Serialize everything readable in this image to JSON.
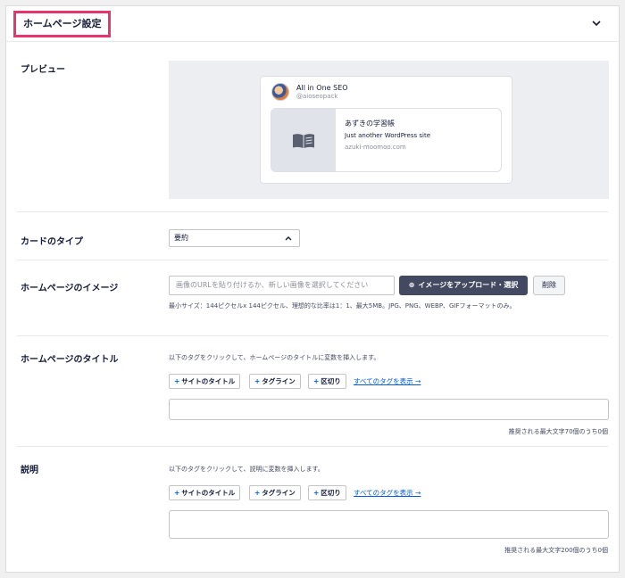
{
  "header": {
    "title": "ホームページ設定"
  },
  "preview": {
    "label": "プレビュー",
    "account_name": "All in One SEO",
    "account_handle": "@aioseopack",
    "card_title": "あずきの学習帳",
    "card_description": "Just another WordPress site",
    "card_url": "azuki-moomoo.com"
  },
  "card_type": {
    "label": "カードのタイプ",
    "selected": "要約"
  },
  "homepage_image": {
    "label": "ホームページのイメージ",
    "placeholder": "画像のURLを貼り付けるか、新しい画像を選択してください",
    "upload_label": "イメージをアップロード・選択",
    "delete_label": "削除",
    "hint": "最小サイズ：144ピクセルx 144ピクセル、理想的な比率は1：1、最大5MB。JPG、PNG、WEBP、GIFフォーマットのみ。"
  },
  "homepage_title": {
    "label": "ホームページのタイトル",
    "hint": "以下のタグをクリックして、ホームページのタイトルに変数を挿入します。",
    "tags": [
      "サイトのタイトル",
      "タグライン",
      "区切り"
    ],
    "show_all": "すべてのタグを表示 →",
    "value": "",
    "counter": "推奨される最大文字70個のうち0個"
  },
  "description": {
    "label": "説明",
    "hint": "以下のタグをクリックして、説明に変数を挿入します。",
    "tags": [
      "サイトのタイトル",
      "タグライン",
      "区切り"
    ],
    "show_all": "すべてのタグを表示 →",
    "value": "",
    "counter": "推奨される最大文字200個のうち0個"
  },
  "colors": {
    "accent_highlight": "#e8336d",
    "primary_button": "#434960",
    "link": "#005ae0"
  },
  "icons": [
    "chevron-down-icon",
    "book-icon",
    "plus-icon",
    "caret-up-icon"
  ]
}
